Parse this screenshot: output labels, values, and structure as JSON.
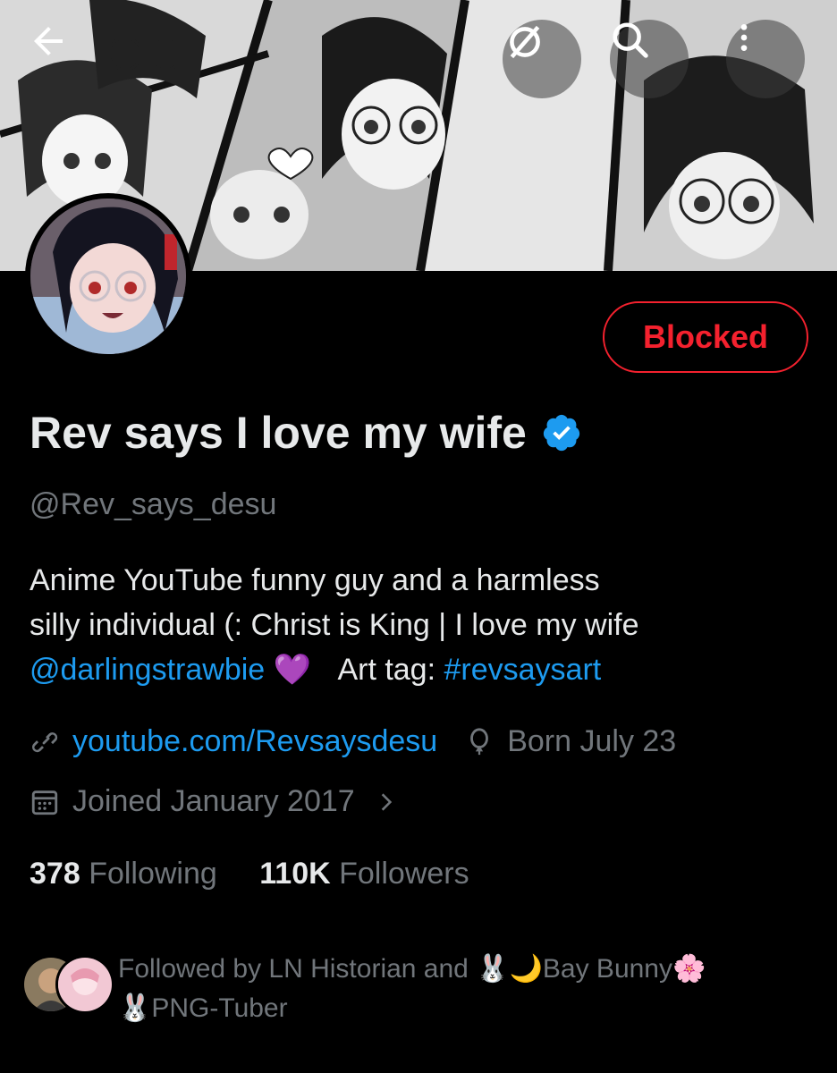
{
  "header": {
    "back_icon": "arrow-left-icon",
    "grok_icon": "slashed-circle-icon",
    "search_icon": "search-icon",
    "more_icon": "more-vertical-icon"
  },
  "profile": {
    "display_name": "Rev says I love my wife",
    "verified": true,
    "handle": "@Rev_says_desu",
    "action_button": "Blocked",
    "bio": {
      "line1": "Anime YouTube funny guy and a harmless",
      "line2": "silly individual (:  Christ is King | I love my wife",
      "mention": "@darlingstrawbie",
      "heart": "💜",
      "art_tag_label": "Art tag:",
      "hashtag": "#revsaysart"
    },
    "website": "youtube.com/Revsaysdesu",
    "birthday": "Born July 23",
    "joined": "Joined January 2017",
    "following_count": "378",
    "following_label": "Following",
    "followers_count": "110K",
    "followers_label": "Followers",
    "followed_by_line1": "Followed by LN Historian and 🐰🌙Bay Bunny🌸",
    "followed_by_line2": "🐰PNG-Tuber"
  },
  "colors": {
    "accent_blue": "#1d9bf0",
    "blocked_red": "#f4212e",
    "muted_text": "#71767b",
    "primary_text": "#e7e9ea"
  }
}
